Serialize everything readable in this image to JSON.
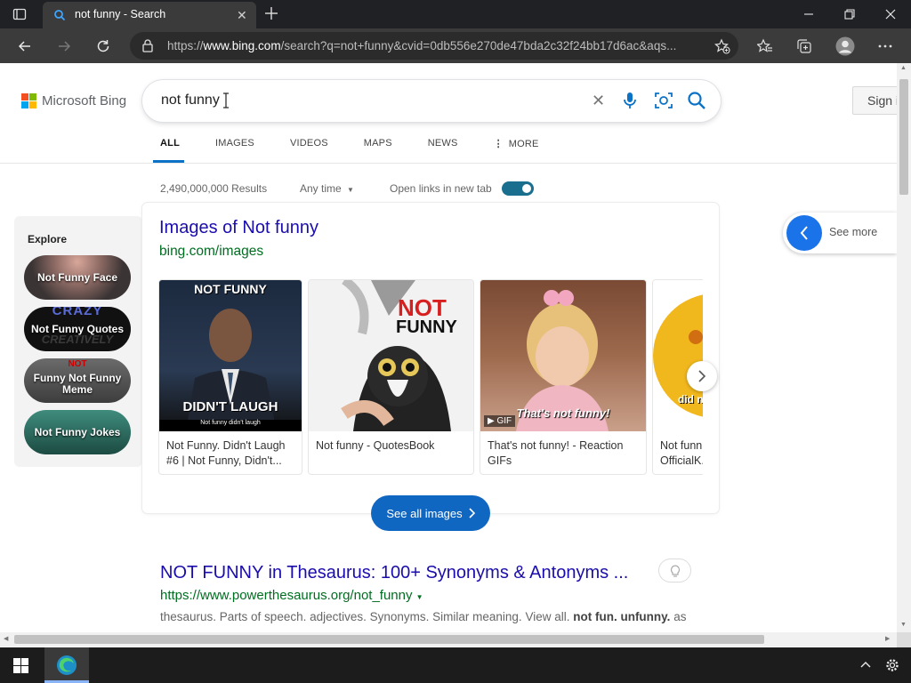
{
  "browser": {
    "tab_title": "not funny - Search",
    "url_prefix": "https://",
    "url_host": "www.bing.com",
    "url_path": "/search?q=not+funny&cvid=0db556e270de47bda2c32f24bb17d6ac&aqs..."
  },
  "bing": {
    "logo_text": "Microsoft Bing",
    "query": "not funny",
    "sign_in": "Sign i",
    "scopes": [
      "ALL",
      "IMAGES",
      "VIDEOS",
      "MAPS",
      "NEWS",
      "MORE"
    ],
    "result_count": "2,490,000,000 Results",
    "time_filter": "Any time",
    "new_tab_label": "Open links in new tab"
  },
  "explore": {
    "title": "Explore",
    "items": [
      "Not Funny Face",
      "Not Funny Quotes",
      "Funny Not Funny Meme",
      "Not Funny Jokes"
    ]
  },
  "images_card": {
    "title": "Images of Not funny",
    "source": "bing.com/images",
    "tiles": [
      {
        "caption": "Not Funny. Didn't Laugh #6 | Not Funny, Didn't...",
        "img_top": "NOT FUNNY",
        "img_bottom": "DIDN'T LAUGH",
        "img_small": "Not funny didn't laugh"
      },
      {
        "caption": "Not funny - QuotesBook",
        "img_top": "NOT",
        "img_bottom": "FUNNY"
      },
      {
        "caption": "That's not funny! - Reaction GIFs",
        "img_overlay": "That's not funny!",
        "badge": "GIF"
      },
      {
        "caption": "Not funn... OfficialK...",
        "img_overlay": "did n... a fi..."
      }
    ],
    "see_all": "See all images",
    "see_more": "See more"
  },
  "result": {
    "title": "NOT FUNNY in Thesaurus: 100+ Synonyms & Antonyms ...",
    "url": "https://www.powerthesaurus.org/not_funny",
    "snippet_plain": "thesaurus. Parts of speech. adjectives. Synonyms. Similar meaning. View all. ",
    "snippet_bold": "not fun. unfunny.",
    "snippet_tail": " as"
  },
  "colors": {
    "link": "#1a0dab",
    "url_green": "#006d21",
    "accent_blue": "#1067c2",
    "toggle_teal": "#1a6e8e"
  }
}
